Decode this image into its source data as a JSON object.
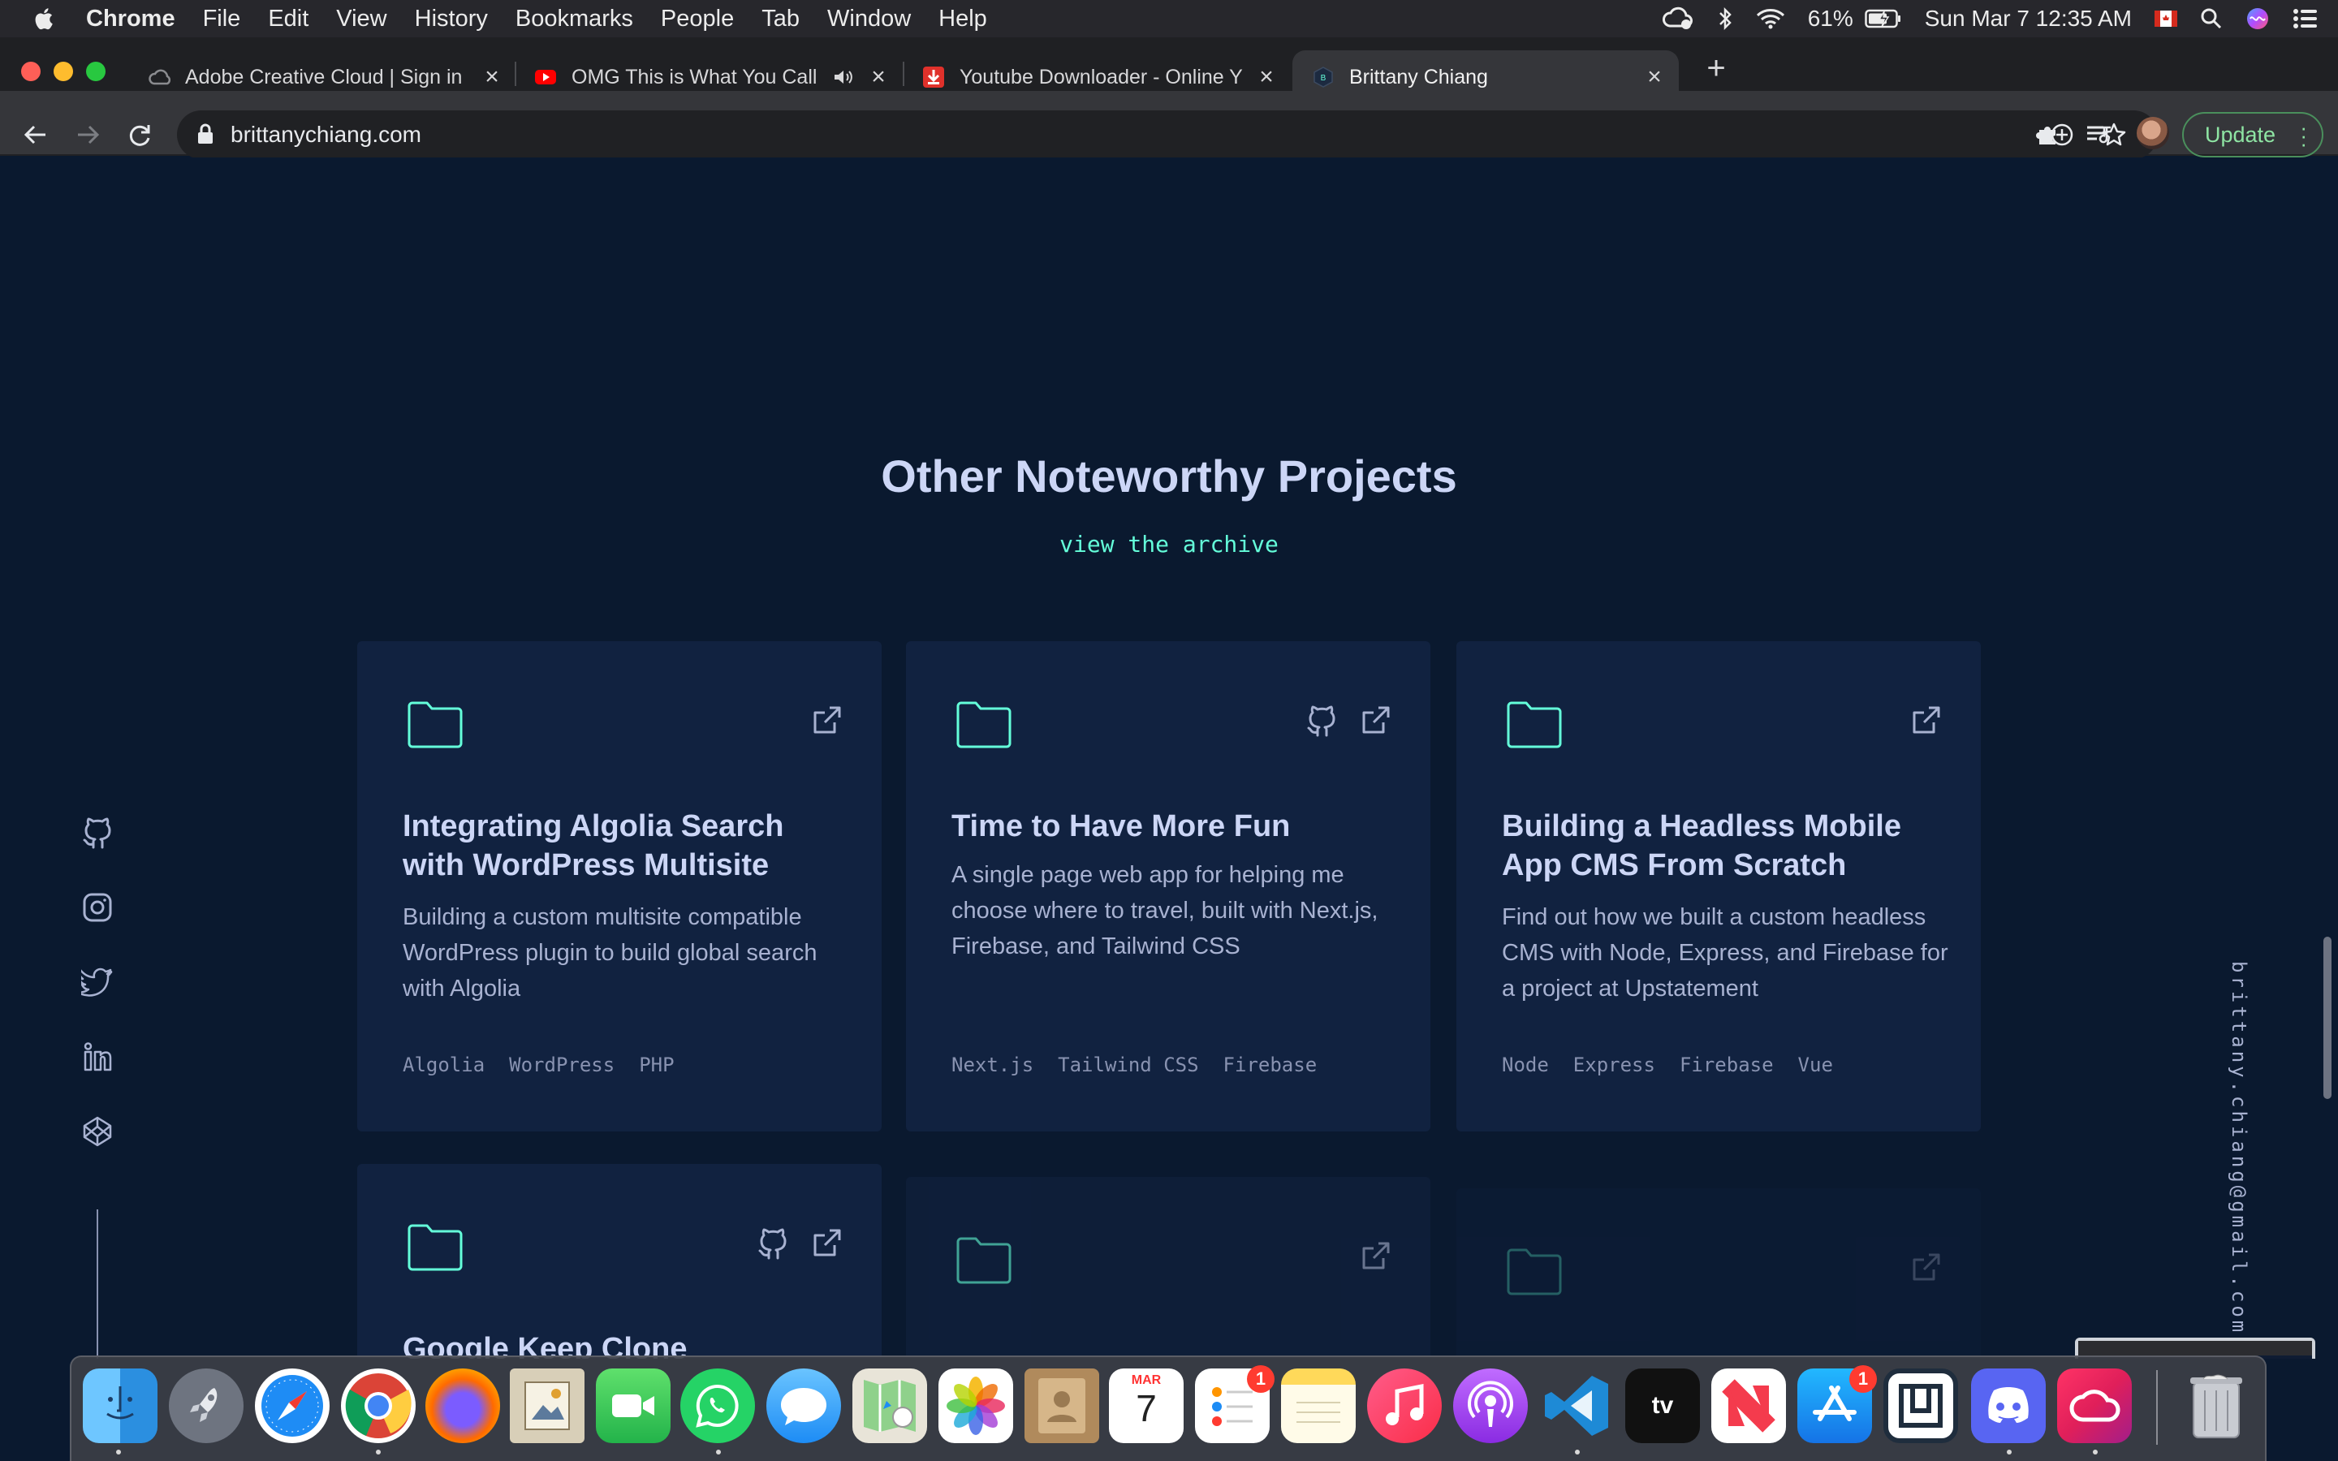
{
  "menubar": {
    "app_name": "Chrome",
    "items": [
      "File",
      "Edit",
      "View",
      "History",
      "Bookmarks",
      "People",
      "Tab",
      "Window",
      "Help"
    ],
    "battery": "61%",
    "clock": "Sun Mar 7  12:35 AM"
  },
  "tabs": [
    {
      "title": "Adobe Creative Cloud | Sign in",
      "icon": "creative-cloud-icon"
    },
    {
      "title": "OMG This is What You Call",
      "icon": "youtube-icon",
      "audio": true
    },
    {
      "title": "Youtube Downloader - Online Y",
      "icon": "download-icon"
    },
    {
      "title": "Brittany Chiang",
      "icon": "site-logo-icon",
      "active": true
    }
  ],
  "toolbar": {
    "url": "brittanychiang.com",
    "update_label": "Update"
  },
  "page": {
    "section_title": "Other Noteworthy Projects",
    "archive_link": "view the archive",
    "email": "brittany.chiang@gmail.com",
    "projects": [
      {
        "title": "Integrating Algolia Search with WordPress Multisite",
        "description": "Building a custom multisite compatible WordPress plugin to build global search with Algolia",
        "tags": [
          "Algolia",
          "WordPress",
          "PHP"
        ]
      },
      {
        "title": "Time to Have More Fun",
        "description": "A single page web app for helping me choose where to travel, built with Next.js, Firebase, and Tailwind CSS",
        "tags": [
          "Next.js",
          "Tailwind CSS",
          "Firebase"
        ]
      },
      {
        "title": "Building a Headless Mobile App CMS From Scratch",
        "description": "Find out how we built a custom headless CMS with Node, Express, and Firebase for a project at Upstatement",
        "tags": [
          "Node",
          "Express",
          "Firebase",
          "Vue"
        ]
      },
      {
        "title": "Google Keep Clone"
      }
    ]
  },
  "dock": {
    "badges": {
      "reminders": "1",
      "app_store": "1"
    },
    "calendar_month": "MAR",
    "calendar_day": "7"
  },
  "colors": {
    "background": "#0a192f",
    "card": "#112240",
    "accent": "#64ffda",
    "heading": "#ccd6f6",
    "text": "#a8b2d1",
    "muted": "#8892b0"
  }
}
